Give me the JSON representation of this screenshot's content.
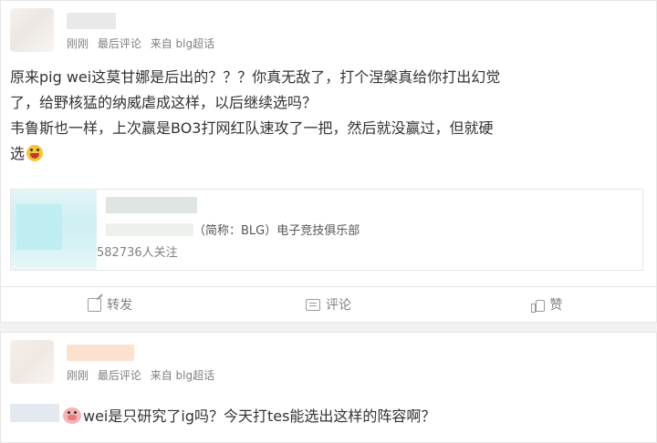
{
  "post1": {
    "meta_time": "刚刚",
    "meta_type": "最后评论",
    "meta_source": "来自 blg超话",
    "lines": [
      "原来pig wei这莫甘娜是后出的？？？你真无敌了，打个涅槃真给你打出幻觉",
      "了，给野核猛的纳威虐成这样，以后继续选吗？",
      "韦鲁斯也一样，上次赢是BO3打网红队速攻了一把，然后就没赢过，但就硬",
      "选"
    ],
    "emoji_icon": "laughing-crying-face-icon",
    "embed": {
      "desc": "（简称：BLG）电子竞技俱乐部",
      "fans": "582736人关注"
    },
    "actions": {
      "share": "转发",
      "comment": "评论",
      "like": "赞"
    }
  },
  "post2": {
    "meta_time": "刚刚",
    "meta_type": "最后评论",
    "meta_source": "来自 blg超话",
    "emoji_icon": "pig-face-icon",
    "text": "wei是只研究了ig吗？今天打tes能选出这样的阵容啊？"
  }
}
